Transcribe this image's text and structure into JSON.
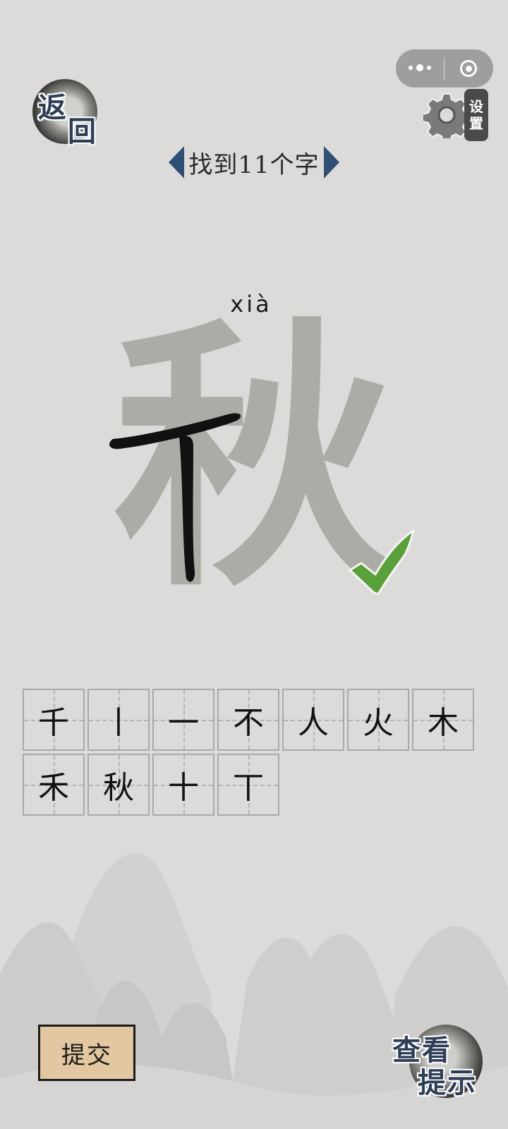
{
  "capsule": {
    "more_icon": "more-dots-icon",
    "close_icon": "target-circle-icon"
  },
  "back": {
    "line1": "返",
    "line2": "回"
  },
  "settings": {
    "icon": "gear-icon",
    "line1": "设",
    "line2": "置"
  },
  "title": {
    "text": "找到11个字"
  },
  "pinyin": "xià",
  "target_char": "秋",
  "check_icon": "check-mark-icon",
  "found_chars": [
    "千",
    "丨",
    "一",
    "不",
    "人",
    "火",
    "木",
    "禾",
    "秋",
    "十",
    "丅"
  ],
  "submit": {
    "label": "提交"
  },
  "hint": {
    "line1": "查看",
    "line2": "提示"
  },
  "colors": {
    "background": "#dcdbda",
    "title_arrow": "#2f4f75",
    "check_green": "#5aa03a",
    "submit_plate": "#e2c7a0"
  }
}
